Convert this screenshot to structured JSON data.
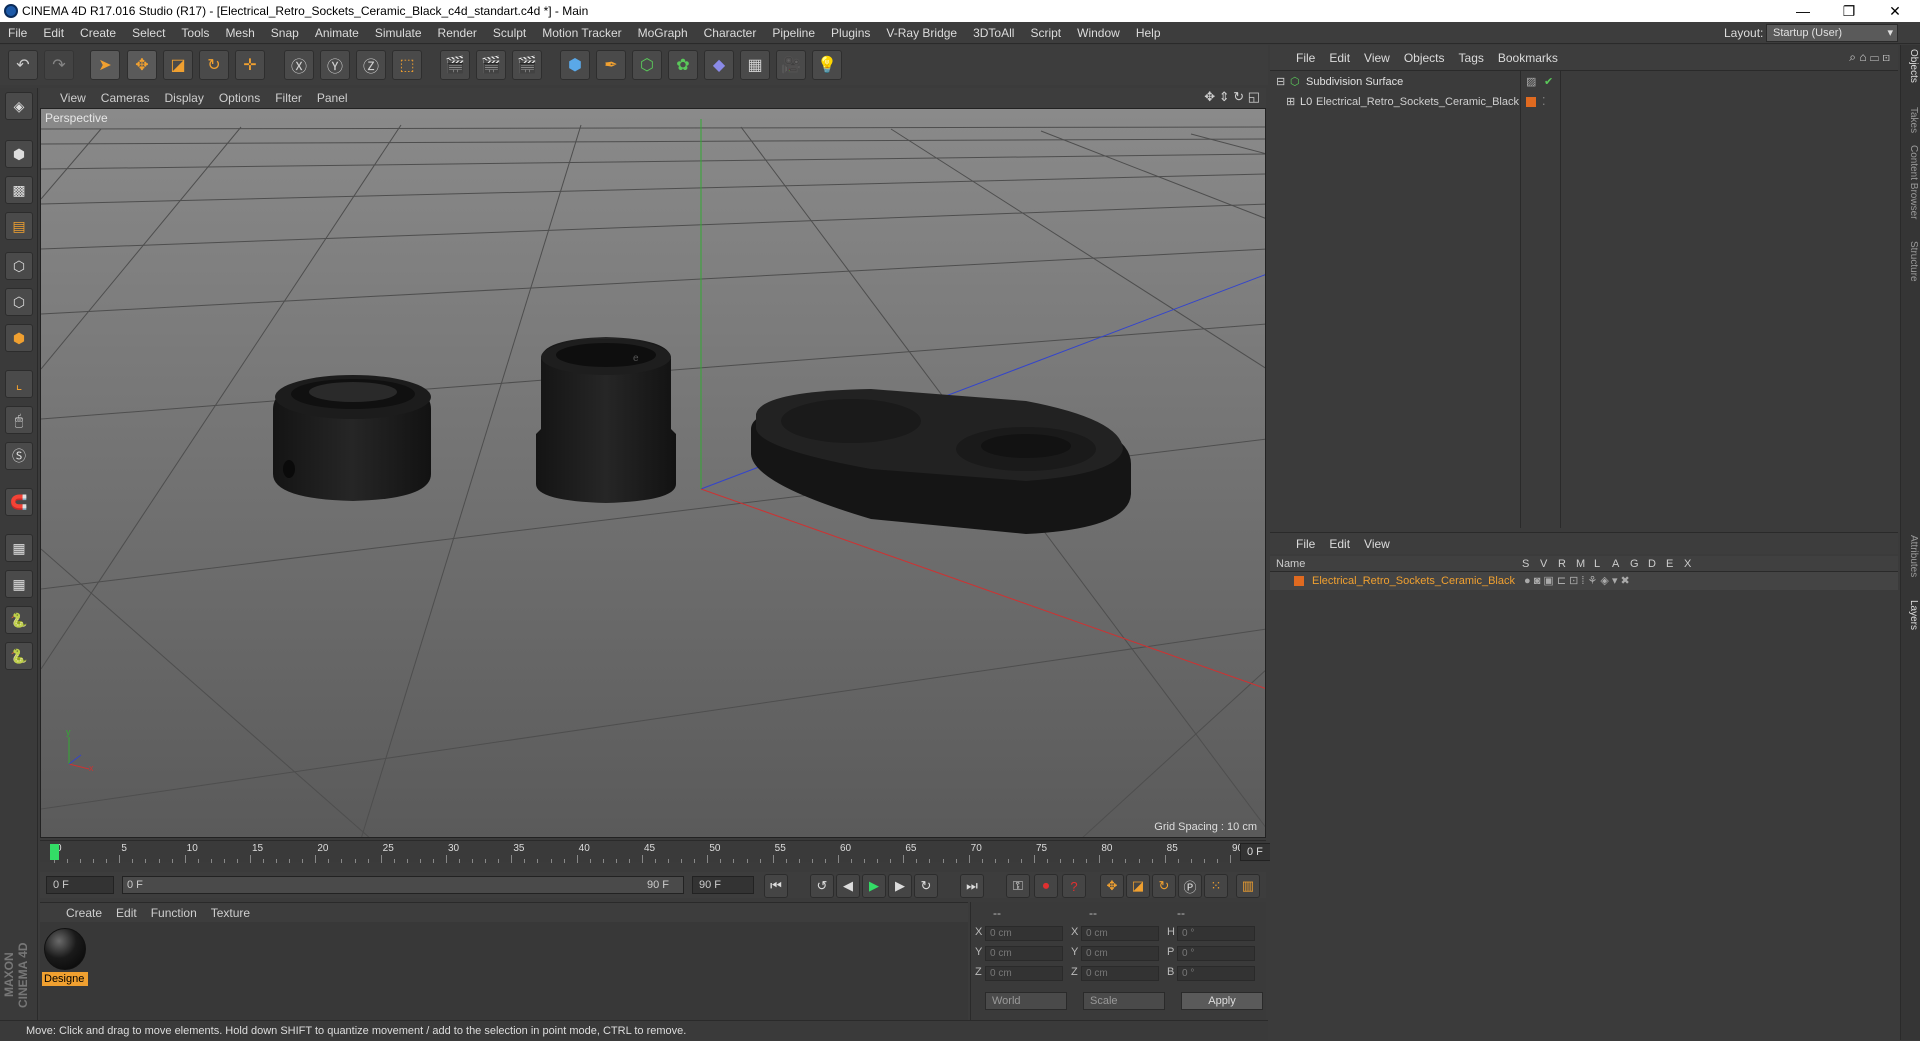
{
  "window": {
    "title": "CINEMA 4D R17.016 Studio (R17) - [Electrical_Retro_Sockets_Ceramic_Black_c4d_standart.c4d *] - Main",
    "minimize": "—",
    "restore": "❐",
    "close": "✕"
  },
  "menubar": {
    "items": [
      "File",
      "Edit",
      "Create",
      "Select",
      "Tools",
      "Mesh",
      "Snap",
      "Animate",
      "Simulate",
      "Render",
      "Sculpt",
      "Motion Tracker",
      "MoGraph",
      "Character",
      "Pipeline",
      "Plugins",
      "V-Ray Bridge",
      "3DToAll",
      "Script",
      "Window",
      "Help"
    ],
    "layout_label": "Layout:",
    "layout_value": "Startup (User)"
  },
  "viewport": {
    "menu": [
      "View",
      "Cameras",
      "Display",
      "Options",
      "Filter",
      "Panel"
    ],
    "label": "Perspective",
    "grid_spacing": "Grid Spacing : 10 cm"
  },
  "timeline": {
    "ticks": [
      "0",
      "5",
      "10",
      "15",
      "20",
      "25",
      "30",
      "35",
      "40",
      "45",
      "50",
      "55",
      "60",
      "65",
      "70",
      "75",
      "80",
      "85",
      "90"
    ],
    "current_frame": "0 F",
    "start_field": "0 F",
    "range_start": "0 F",
    "range_end": "90 F",
    "end_field": "90 F"
  },
  "material_manager": {
    "menu": [
      "Create",
      "Edit",
      "Function",
      "Texture"
    ],
    "materials": [
      {
        "name": "Designe"
      }
    ]
  },
  "coordinates": {
    "header": [
      "--",
      "--",
      "--"
    ],
    "rows": [
      {
        "a": "X",
        "av": "0 cm",
        "b": "X",
        "bv": "0 cm",
        "c": "H",
        "cv": "0 °"
      },
      {
        "a": "Y",
        "av": "0 cm",
        "b": "Y",
        "bv": "0 cm",
        "c": "P",
        "cv": "0 °"
      },
      {
        "a": "Z",
        "av": "0 cm",
        "b": "Z",
        "bv": "0 cm",
        "c": "B",
        "cv": "0 °"
      }
    ],
    "mode1": "World",
    "mode2": "Scale",
    "apply": "Apply"
  },
  "status": "Move: Click and drag to move elements. Hold down SHIFT to quantize movement / add to the selection in point mode, CTRL to remove.",
  "object_manager": {
    "menu": [
      "File",
      "Edit",
      "View",
      "Objects",
      "Tags",
      "Bookmarks"
    ],
    "objects": [
      {
        "name": "Subdivision Surface"
      },
      {
        "name": "Electrical_Retro_Sockets_Ceramic_Black"
      }
    ]
  },
  "layer_manager": {
    "menu": [
      "File",
      "Edit",
      "View"
    ],
    "columns": [
      "Name",
      "S",
      "V",
      "R",
      "M",
      "L",
      "A",
      "G",
      "D",
      "E",
      "X"
    ],
    "layers": [
      {
        "name": "Electrical_Retro_Sockets_Ceramic_Black",
        "color": "#e06a20"
      }
    ]
  },
  "right_tabs": [
    "Objects",
    "Takes",
    "Content Browser",
    "Structure",
    "Attributes",
    "Layers"
  ],
  "logo": "MAXON CINEMA 4D",
  "colors": {
    "accent": "#f0a030",
    "layer_swatch": "#e06a20",
    "x_axis": "#cc3333",
    "y_axis": "#33aa33",
    "z_axis": "#3344cc"
  }
}
